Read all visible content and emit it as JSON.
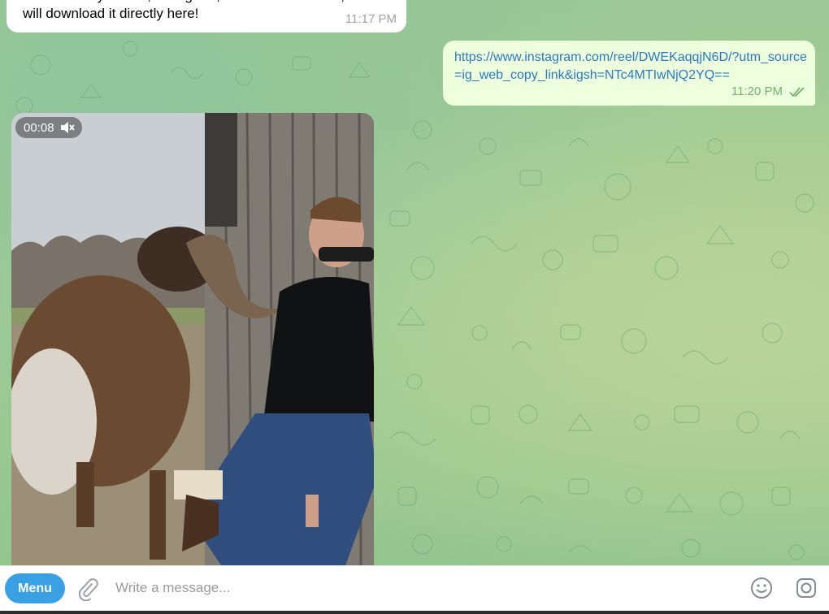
{
  "messages": {
    "incoming": {
      "text": "Send me any TikTok, Instagram, or SoundCloud link, and I will download it directly here!",
      "time": "11:17 PM"
    },
    "outgoing": {
      "link": "https://www.instagram.com/reel/DWEKaqqjN6D/?utm_source=ig_web_copy_link&igsh=NTc4MTIwNjQ2YQ==",
      "time": "11:20 PM",
      "status": "read"
    },
    "video": {
      "duration": "00:08",
      "muted": true
    }
  },
  "composer": {
    "menu_label": "Menu",
    "placeholder": "Write a message..."
  },
  "icons": {
    "attach": "paperclip-icon",
    "emoji": "emoji-icon",
    "camera": "instant-camera-icon",
    "mute": "speaker-muted-icon",
    "read": "double-check-icon"
  },
  "colors": {
    "accent": "#3aa0e4",
    "outgoing_bubble": "#eeffde",
    "link": "#2a78c2",
    "read_check": "#6fb36a"
  }
}
